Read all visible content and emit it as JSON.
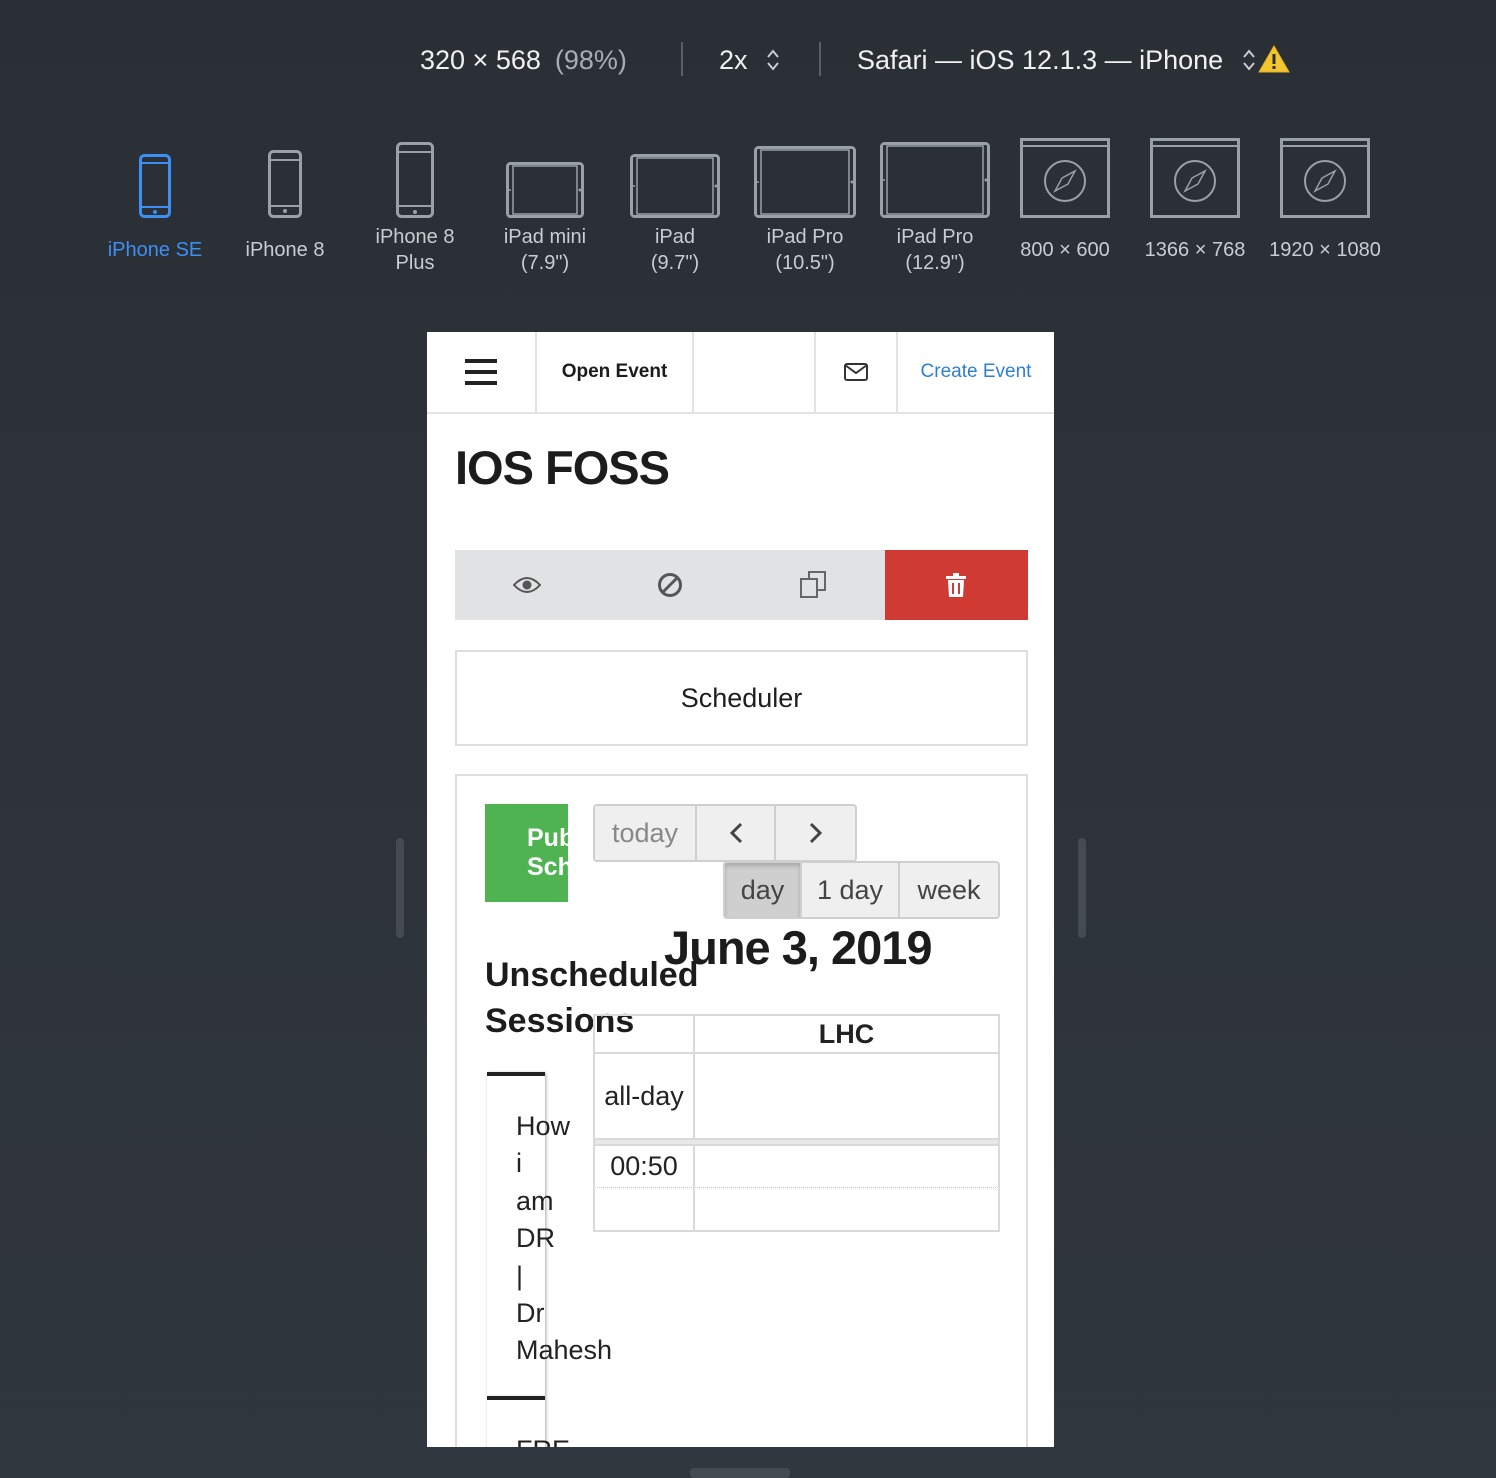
{
  "info_bar": {
    "dimensions": "320 × 568",
    "zoom": "(98%)",
    "scale": "2x",
    "browser": "Safari — iOS 12.1.3 — iPhone"
  },
  "devices": [
    {
      "label": "iPhone SE",
      "active": true
    },
    {
      "label": "iPhone 8"
    },
    {
      "label_line1": "iPhone 8",
      "label_line2": "Plus"
    },
    {
      "label_line1": "iPad mini",
      "label_line2": "(7.9\")"
    },
    {
      "label_line1": "iPad",
      "label_line2": "(9.7\")"
    },
    {
      "label_line1": "iPad Pro",
      "label_line2": "(10.5\")"
    },
    {
      "label_line1": "iPad Pro",
      "label_line2": "(12.9\")"
    },
    {
      "label": "800 × 600"
    },
    {
      "label": "1366 × 768"
    },
    {
      "label": "1920 × 1080"
    }
  ],
  "colors": {
    "active_device": "#3b8ff5",
    "link": "#2f7fd1",
    "danger": "#cf3b32",
    "publish": "#4fb352"
  },
  "navbar": {
    "menu_icon": "hamburger-icon",
    "brand": "Open Event",
    "mail_icon": "envelope-icon",
    "create_event": "Create Event"
  },
  "event": {
    "title": "IOS FOSS"
  },
  "toolbar": {
    "icons": [
      "eye-icon",
      "ban-icon",
      "copy-icon",
      "trash-icon"
    ]
  },
  "scheduler_tab": "Scheduler",
  "calendar": {
    "publish_line1": "Publish",
    "publish_line2": "Schedule",
    "today": "today",
    "view_day": "day",
    "view_oneday": "1 day",
    "view_week": "week",
    "date": "June 3, 2019",
    "unscheduled": "Unscheduled Sessions",
    "room": "LHC",
    "allday": "all-day",
    "time1": "00:50",
    "sessions": [
      "How\ni\nam\nDR\n|\nDr\nMahesh",
      "FRE"
    ]
  }
}
